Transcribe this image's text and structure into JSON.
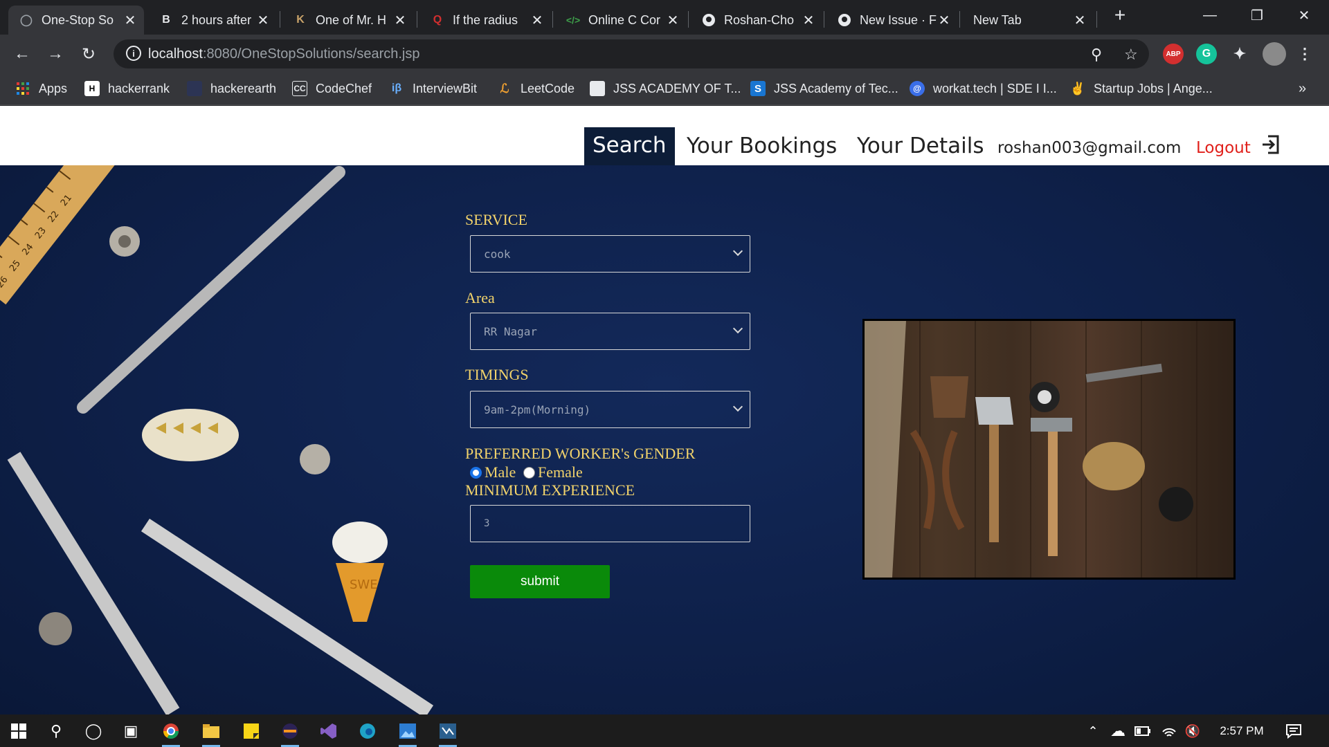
{
  "browser": {
    "tabs": [
      {
        "title": "One-Stop So",
        "active": true
      },
      {
        "title": "2 hours after"
      },
      {
        "title": "One of Mr. H"
      },
      {
        "title": "If the radius"
      },
      {
        "title": "Online C Cor"
      },
      {
        "title": "Roshan-Cho"
      },
      {
        "title": "New Issue · F"
      },
      {
        "title": "New Tab"
      }
    ],
    "new_tab_symbol": "+",
    "url_host": "localhost",
    "url_rest": ":8080/OneStopSolutions/search.jsp",
    "extensions": [
      "ABP",
      "G"
    ],
    "bookmarks": [
      {
        "label": "Apps"
      },
      {
        "label": "hackerrank"
      },
      {
        "label": "hackerearth"
      },
      {
        "label": "CodeChef"
      },
      {
        "label": "InterviewBit"
      },
      {
        "label": "LeetCode"
      },
      {
        "label": "JSS ACADEMY OF T..."
      },
      {
        "label": "JSS Academy of Tec..."
      },
      {
        "label": "workat.tech | SDE I I..."
      },
      {
        "label": "Startup Jobs | Ange..."
      }
    ],
    "more_bookmarks": "»"
  },
  "site_nav": {
    "search": "Search",
    "bookmarks": "Your Bookings",
    "details": "Your Details",
    "email": "roshan003@gmail.com",
    "logout": "Logout"
  },
  "form": {
    "service_label": "SERVICE",
    "service_value": "cook",
    "area_label": "Area",
    "area_value": "RR Nagar",
    "timings_label": "TIMINGS",
    "timings_value": "9am-2pm(Morning)",
    "gender_label": "PREFERRED WORKER's GENDER",
    "gender_male": "Male",
    "gender_female": "Female",
    "gender_selected": "Male",
    "experience_label": "MINIMUM EXPERIENCE",
    "experience_value": "3",
    "submit_label": "submit"
  },
  "decor": {
    "ruler_marks": [
      "21",
      "22",
      "23",
      "24",
      "25",
      "26"
    ],
    "cone_text": "SWE"
  },
  "taskbar": {
    "time": "2:57 PM"
  },
  "colors": {
    "label_gold": "#f2d36b",
    "page_bg": "#0e2049",
    "submit_green": "#0a8a0a",
    "logout_red": "#e0201b"
  }
}
